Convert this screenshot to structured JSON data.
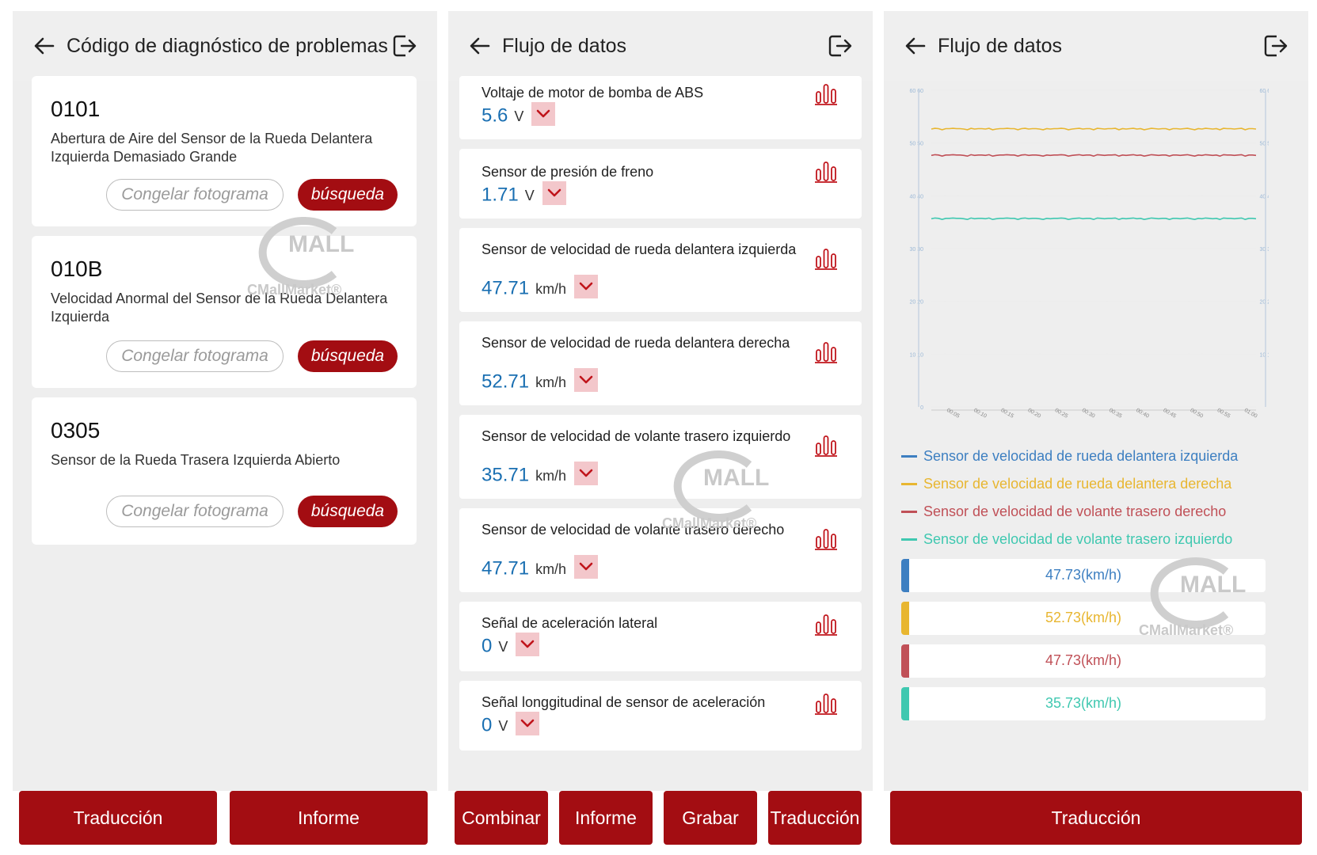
{
  "panel1": {
    "title": "Código de diagnóstico de problemas",
    "cards": [
      {
        "code": "0101",
        "desc": "Abertura de Aire del Sensor de la Rueda Delantera Izquierda Demasiado Grande",
        "freeze": "Congelar fotograma",
        "search": "búsqueda"
      },
      {
        "code": "010B",
        "desc": "Velocidad Anormal del Sensor de la Rueda Delantera Izquierda",
        "freeze": "Congelar fotograma",
        "search": "búsqueda"
      },
      {
        "code": "0305",
        "desc": "Sensor de la Rueda Trasera Izquierda Abierto",
        "freeze": "Congelar fotograma",
        "search": "búsqueda"
      }
    ],
    "buttons": [
      "Traducción",
      "Informe"
    ]
  },
  "panel2": {
    "title": "Flujo de datos",
    "rows": [
      {
        "name": "Voltaje de motor de bomba de ABS",
        "value": "5.6",
        "unit": "V"
      },
      {
        "name": "Sensor de presión de freno",
        "value": "1.71",
        "unit": "V"
      },
      {
        "name": "Sensor de velocidad de rueda delantera izquierda",
        "value": "47.71",
        "unit": "km/h"
      },
      {
        "name": "Sensor de velocidad de rueda delantera derecha",
        "value": "52.71",
        "unit": "km/h"
      },
      {
        "name": "Sensor de velocidad de volante trasero izquierdo",
        "value": "35.71",
        "unit": "km/h"
      },
      {
        "name": "Sensor de velocidad de volante trasero derecho",
        "value": "47.71",
        "unit": "km/h"
      },
      {
        "name": "Señal de aceleración lateral",
        "value": "0",
        "unit": "V"
      },
      {
        "name": "Señal longgitudinal de sensor de aceleración",
        "value": "0",
        "unit": "V"
      }
    ],
    "buttons": [
      "Combinar",
      "Informe",
      "Grabar",
      "Traducción"
    ]
  },
  "panel3": {
    "title": "Flujo de datos",
    "legend": [
      {
        "name": "Sensor de velocidad de rueda delantera izquierda",
        "color": "#3d7fc1"
      },
      {
        "name": "Sensor de velocidad de rueda delantera derecha",
        "color": "#e8b630"
      },
      {
        "name": "Sensor de velocidad de volante trasero derecho",
        "color": "#c05057"
      },
      {
        "name": "Sensor de velocidad de volante trasero izquierdo",
        "color": "#3fc8b0"
      }
    ],
    "values": [
      {
        "text": "47.73(km/h)",
        "color": "#3d7fc1"
      },
      {
        "text": "52.73(km/h)",
        "color": "#e8b630"
      },
      {
        "text": "47.73(km/h)",
        "color": "#c05057"
      },
      {
        "text": "35.73(km/h)",
        "color": "#3fc8b0"
      }
    ],
    "button": "Traducción"
  },
  "watermark": {
    "mall": "MALL",
    "brand": "CMallMarket®"
  },
  "chart_data": {
    "type": "line",
    "x": [
      "00:05",
      "00:10",
      "00:15",
      "00:20",
      "00:25",
      "00:30",
      "00:35",
      "00:40",
      "00:45",
      "00:50",
      "00:55",
      "01:00"
    ],
    "yticks_left": [
      "60 60",
      "50 50",
      "40 40",
      "30 30",
      "20 20",
      "10 10",
      "0"
    ],
    "yticks_right": [
      "60 60",
      "50 50",
      "40 40",
      "30 30",
      "20 20",
      "10 10",
      "0"
    ],
    "ylim": [
      0,
      60
    ],
    "series": [
      {
        "name": "Sensor de velocidad de rueda delantera izquierda",
        "color": "#3d7fc1",
        "values": []
      },
      {
        "name": "Sensor de velocidad de rueda delantera derecha",
        "color": "#e8b630",
        "values": [
          52.7,
          52.7,
          52.7,
          52.7,
          52.7,
          52.7,
          52.7,
          52.7,
          52.7,
          52.7,
          52.7,
          52.7
        ]
      },
      {
        "name": "Sensor de velocidad de volante trasero derecho",
        "color": "#c05057",
        "values": [
          47.7,
          47.7,
          47.7,
          47.7,
          47.7,
          47.7,
          47.7,
          47.7,
          47.7,
          47.7,
          47.7,
          47.7
        ]
      },
      {
        "name": "Sensor de velocidad de volante trasero izquierdo",
        "color": "#3fc8b0",
        "values": [
          35.7,
          35.7,
          35.7,
          35.7,
          35.7,
          35.7,
          35.7,
          35.7,
          35.7,
          35.7,
          35.7,
          35.7
        ]
      }
    ],
    "grid": true
  }
}
